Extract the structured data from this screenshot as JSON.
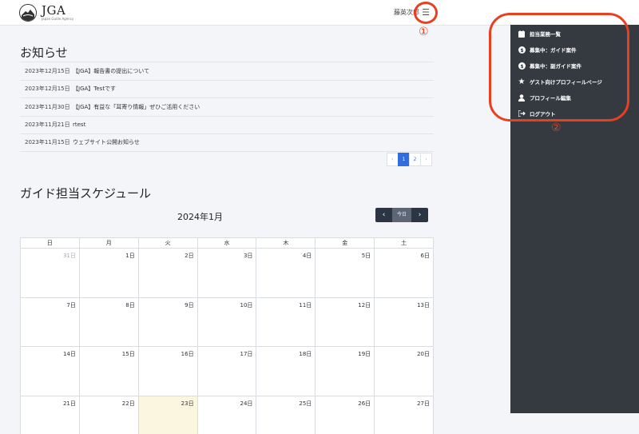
{
  "header": {
    "logo_title": "JGA",
    "logo_subtitle": "Japan Guide Agency",
    "user_name": "藤英次郎",
    "menu_icon": "hamburger-icon"
  },
  "annotations": {
    "marker1": "①",
    "marker2": "②",
    "color": "#e8401f"
  },
  "notices": {
    "title": "お知らせ",
    "items": [
      {
        "date": "2023年12月15日",
        "title": "【JGA】報告書の提出について"
      },
      {
        "date": "2023年12月15日",
        "title": "【JGA】Testです"
      },
      {
        "date": "2023年11月30日",
        "title": "【JGA】有益な「耳寄り情報」ぜひご活用ください"
      },
      {
        "date": "2023年11月21日",
        "title": "rtest"
      },
      {
        "date": "2023年11月15日",
        "title": "ウェブサイト公開お知らせ"
      }
    ],
    "pager": {
      "prev": "‹",
      "pages": [
        "1",
        "2"
      ],
      "next": "›",
      "current": "1"
    }
  },
  "schedule": {
    "title": "ガイド担当スケジュール",
    "month": "2024年1月",
    "prev_label": "‹",
    "today_label": "今日",
    "next_label": "›",
    "weekdays": [
      "日",
      "月",
      "火",
      "水",
      "木",
      "金",
      "土"
    ],
    "weeks": [
      [
        "31日",
        "1日",
        "2日",
        "3日",
        "4日",
        "5日",
        "6日"
      ],
      [
        "7日",
        "8日",
        "9日",
        "10日",
        "11日",
        "12日",
        "13日"
      ],
      [
        "14日",
        "15日",
        "16日",
        "17日",
        "18日",
        "19日",
        "20日"
      ],
      [
        "21日",
        "22日",
        "23日",
        "24日",
        "25日",
        "26日",
        "27日"
      ]
    ],
    "today_date": "23日"
  },
  "sidebar": {
    "background": "#343a40",
    "items": [
      {
        "label": "担当業務一覧",
        "icon": "calendar-icon"
      },
      {
        "label": "募集中：ガイド案件",
        "icon": "dollar-circle-icon"
      },
      {
        "label": "募集中：副ガイド案件",
        "icon": "dollar-circle-icon"
      },
      {
        "label": "ゲスト向けプロフィールページ",
        "icon": "star-icon"
      },
      {
        "label": "プロフィール編集",
        "icon": "user-icon"
      },
      {
        "label": "ログアウト",
        "icon": "logout-icon"
      }
    ]
  }
}
